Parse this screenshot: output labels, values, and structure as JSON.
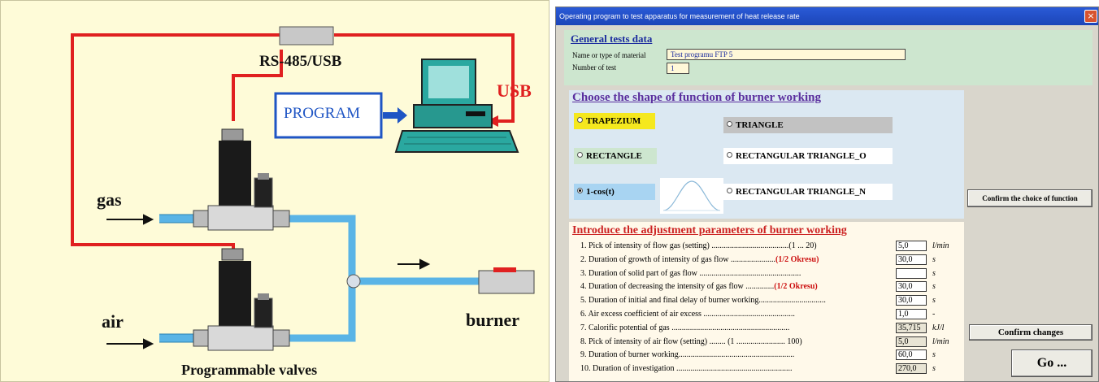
{
  "diagram": {
    "labels": {
      "rs485": "RS-485/USB",
      "usb": "USB",
      "program": "PROGRAM",
      "gas": "gas",
      "air": "air",
      "burner": "burner",
      "valves": "Programmable valves"
    },
    "colors": {
      "background": "#fefbd8",
      "cable_red": "#e02020",
      "pipe_blue": "#5ab4e6",
      "program_border": "#1f55c4"
    }
  },
  "window": {
    "title": "Operating program to test apparatus for measurement of heat release rate",
    "close_icon": "×",
    "general": {
      "heading": "General tests data",
      "material_label": "Name or type of material",
      "material_value": "Test programu FTP 5",
      "test_number_label": "Number of test",
      "test_number_value": "1"
    },
    "shape": {
      "heading": "Choose the shape of function of burner working",
      "options": [
        {
          "label": "TRAPEZIUM",
          "selected": false
        },
        {
          "label": "TRIANGLE",
          "selected": false
        },
        {
          "label": "RECTANGLE",
          "selected": false
        },
        {
          "label": "RECTANGULAR TRIANGLE_O",
          "selected": false
        },
        {
          "label": "1-cos(t)",
          "selected": true
        },
        {
          "label": "RECTANGULAR TRIANGLE_N",
          "selected": false
        }
      ]
    },
    "params": {
      "heading": "Introduce the adjustment parameters of burner working",
      "rows": [
        {
          "text": "1. Pick of intensity of flow gas  (setting) ......................................(1 ... 20)",
          "red": "",
          "value": "5,0",
          "unit": "l/min"
        },
        {
          "text": "2. Duration of growth of intensity of gas flow ......................",
          "red": "(1/2 Okresu)",
          "value": "30,0",
          "unit": "s"
        },
        {
          "text": "3. Duration of solid part of  gas flow ..................................................",
          "red": "",
          "value": "",
          "unit": "s"
        },
        {
          "text": "4. Duration of decreasing the intensity of gas flow ..............",
          "red": "(1/2 Okresu)",
          "value": "30,0",
          "unit": "s"
        },
        {
          "text": "5. Duration of initial and final delay of burner working.................................",
          "red": "",
          "value": "30,0",
          "unit": "s"
        },
        {
          "text": "6. Air excess coefficient of air excess .............................................",
          "red": "",
          "value": "1,0",
          "unit": "-"
        },
        {
          "text": "7. Calorific potential of gas ..........................................................",
          "red": "",
          "value": "35,715",
          "unit": "kJ/l"
        },
        {
          "text": "8. Pick of intensity of air flow (setting) ........ (1 ........................ 100)",
          "red": "",
          "value": "5,0",
          "unit": "l/min"
        },
        {
          "text": "9. Duration of burner working.........................................................",
          "red": "",
          "value": "60,0",
          "unit": "s"
        },
        {
          "text": "10. Duration of investigation .........................................................",
          "red": "",
          "value": "270,0",
          "unit": "s"
        }
      ]
    },
    "buttons": {
      "confirm_function": "Confirm the choice of function",
      "confirm_changes": "Confirm changes",
      "go": "Go ..."
    }
  }
}
